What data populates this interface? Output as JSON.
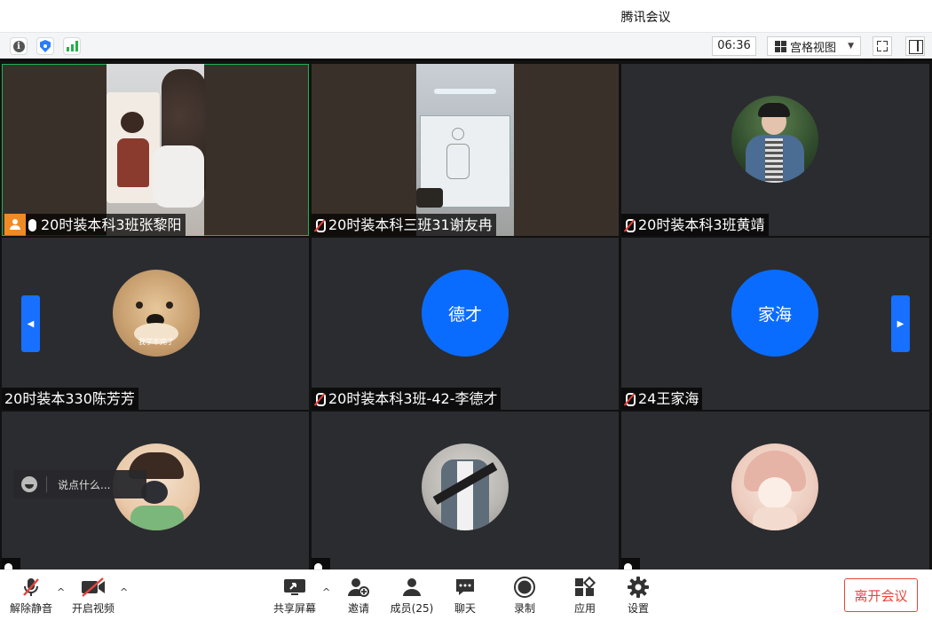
{
  "window": {
    "title": "腾讯会议"
  },
  "toolbar": {
    "icons": [
      "info-icon",
      "shield-icon",
      "signal-icon"
    ],
    "timer": "06:36",
    "view_label": "宫格视图"
  },
  "participants": [
    {
      "name": "20时装本科3班张黎阳",
      "mic": "on",
      "host": true,
      "kind": "video"
    },
    {
      "name": "20时装本科三班31谢友冉",
      "mic": "muted",
      "host": false,
      "kind": "video"
    },
    {
      "name": "20时装本科3班黄靖",
      "mic": "muted",
      "host": false,
      "kind": "avatar"
    },
    {
      "name": "20时装本330陈芳芳",
      "mic": "none",
      "host": false,
      "kind": "avatar",
      "avatar_caption": "我学不完了"
    },
    {
      "name": "20时装本科3班-42-李德才",
      "mic": "muted",
      "host": false,
      "kind": "text-avatar",
      "initials": "德才"
    },
    {
      "name": "24王家海",
      "mic": "muted",
      "host": false,
      "kind": "text-avatar",
      "initials": "家海"
    },
    {
      "name": "",
      "mic": "on",
      "host": false,
      "kind": "avatar"
    },
    {
      "name": "",
      "mic": "on",
      "host": false,
      "kind": "avatar"
    },
    {
      "name": "",
      "mic": "on",
      "host": false,
      "kind": "avatar"
    }
  ],
  "chat": {
    "placeholder": "说点什么..."
  },
  "bottombar": {
    "unmute": "解除静音",
    "start_video": "开启视频",
    "share_screen": "共享屏幕",
    "invite": "邀请",
    "members": "成员(25)",
    "chat": "聊天",
    "record": "录制",
    "apps": "应用",
    "settings": "设置",
    "leave": "离开会议"
  },
  "colors": {
    "accent": "#0a6cff",
    "host": "#f08a24",
    "leave": "#e8443c",
    "active_border": "#1fb24f"
  }
}
